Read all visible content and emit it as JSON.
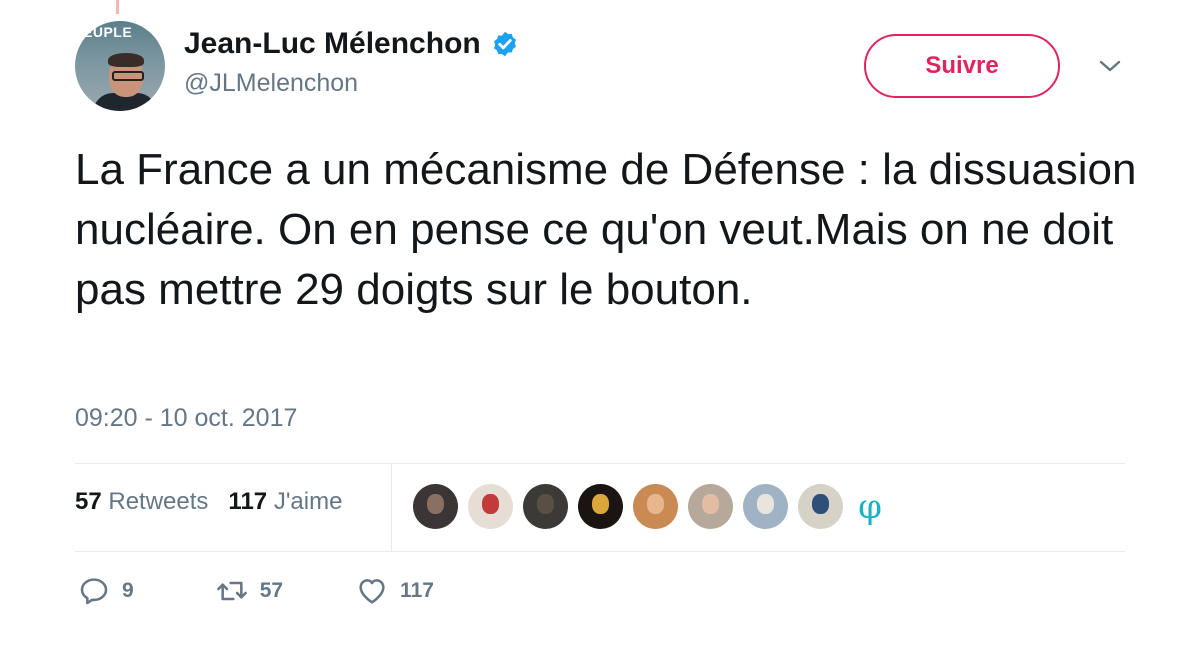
{
  "author": {
    "avatar_text": "EUPLE",
    "name": "Jean-Luc Mélenchon",
    "handle": "@JLMelenchon",
    "verified": true
  },
  "follow_button": {
    "label": "Suivre"
  },
  "tweet": {
    "text": "La France a un mécanisme de Défense : la dissuasion nucléaire. On en pense ce qu'on veut.Mais on ne doit pas mettre 29 doigts sur le bouton.",
    "timestamp": "09:20 - 10 oct. 2017"
  },
  "stats": {
    "retweets_count": "57",
    "retweets_label": "Retweets",
    "likes_count": "117",
    "likes_label": "J'aime"
  },
  "likers": {
    "avatars": [
      {
        "bg": "#3b3535",
        "face": "#8a6f63"
      },
      {
        "bg": "#e6ded5",
        "face": "#c23b3b"
      },
      {
        "bg": "#3c3a36",
        "face": "#5a4f45"
      },
      {
        "bg": "#1a1412",
        "face": "#d9a73a"
      },
      {
        "bg": "#c98a54",
        "face": "#e8b58c"
      },
      {
        "bg": "#b7a89c",
        "face": "#e2bda3"
      },
      {
        "bg": "#9fb3c5",
        "face": "#e9e5dd"
      },
      {
        "bg": "#d7d2c8",
        "face": "#2f4f7a"
      }
    ],
    "last_symbol": "φ"
  },
  "actions": {
    "reply_count": "9",
    "retweet_count": "57",
    "like_count": "117"
  },
  "colors": {
    "follow_accent": "#e0245e",
    "verified_blue": "#1da1f2",
    "secondary_text": "#657786",
    "phi_teal": "#1ab3c4"
  }
}
